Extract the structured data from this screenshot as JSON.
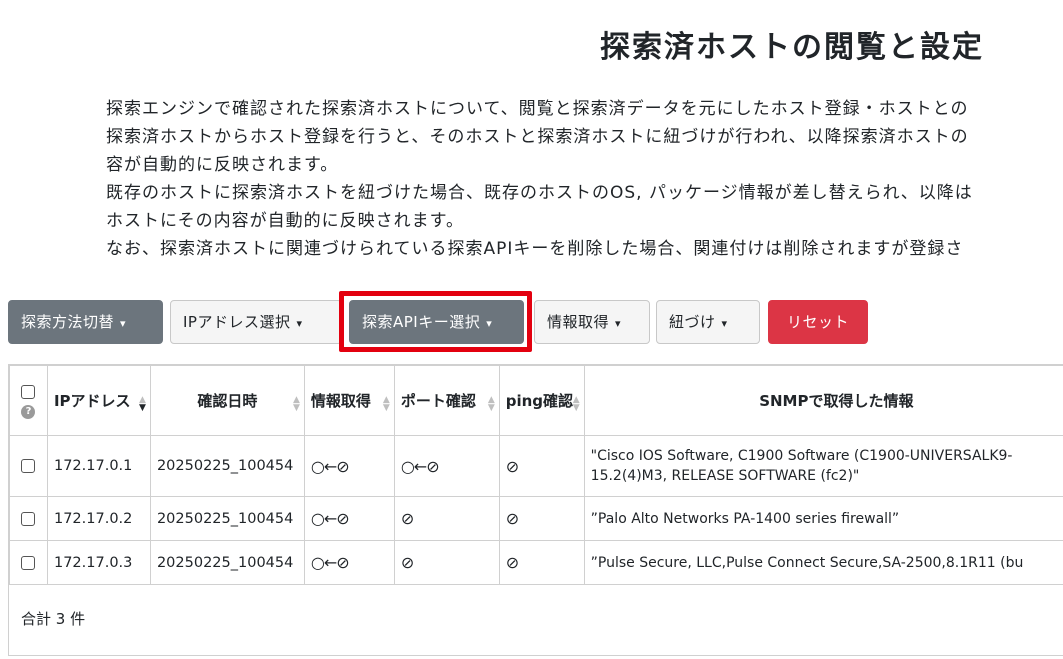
{
  "page": {
    "title": "探索済ホストの閲覧と設定",
    "description": [
      "探索エンジンで確認された探索済ホストについて、閲覧と探索済データを元にしたホスト登録・ホストとの",
      "探索済ホストからホスト登録を行うと、そのホストと探索済ホストに紐づけが行われ、以降探索済ホストの",
      "容が自動的に反映されます。",
      "既存のホストに探索済ホストを紐づけた場合、既存のホストのOS, パッケージ情報が差し替えられ、以降は",
      "ホストにその内容が自動的に反映されます。",
      "なお、探索済ホストに関連づけられている探索APIキーを削除した場合、関連付けは削除されますが登録さ"
    ]
  },
  "toolbar": {
    "search_method": "探索方法切替",
    "ip_select": "IPアドレス選択",
    "api_key_select": "探索APIキー選択",
    "info_get": "情報取得",
    "link": "紐づけ",
    "reset": "リセット",
    "caret": "▾"
  },
  "table": {
    "headers": {
      "help": "?",
      "ip": "IPアドレス",
      "datetime": "確認日時",
      "info": "情報取得",
      "port": "ポート確認",
      "ping": "ping確認",
      "snmp": "SNMPで取得した情報"
    },
    "rows": [
      {
        "ip": "172.17.0.1",
        "datetime": "20250225_100454",
        "info": "○←⊘",
        "port": "○←⊘",
        "ping": "⊘",
        "snmp": "\"Cisco IOS Software, C1900 Software (C1900-UNIVERSALK9-",
        "snmp2": "15.2(4)M3, RELEASE SOFTWARE (fc2)\""
      },
      {
        "ip": "172.17.0.2",
        "datetime": "20250225_100454",
        "info": "○←⊘",
        "port": "⊘",
        "ping": "⊘",
        "snmp": "”Palo Alto Networks PA-1400 series firewall”"
      },
      {
        "ip": "172.17.0.3",
        "datetime": "20250225_100454",
        "info": "○←⊘",
        "port": "⊘",
        "ping": "⊘",
        "snmp": "”Pulse Secure, LLC,Pulse Connect Secure,SA-2500,8.1R11 (bu"
      }
    ],
    "total": "合計 3 件"
  },
  "colors": {
    "dark_button": "#6c757d",
    "danger_button": "#dc3545",
    "highlight_border": "#e3000f"
  }
}
